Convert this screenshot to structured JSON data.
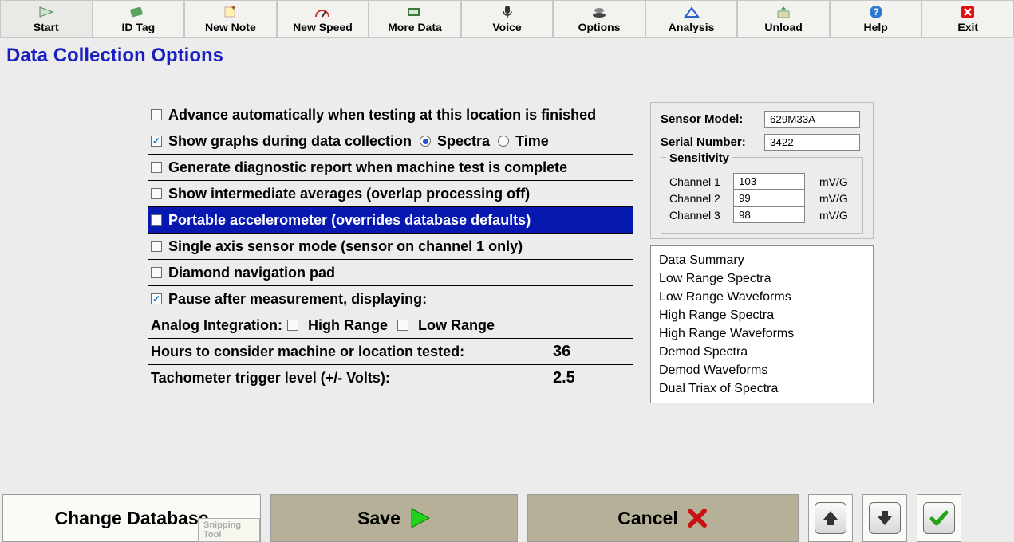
{
  "toolbar": [
    {
      "label": "Start",
      "name": "start-button",
      "icon": "start"
    },
    {
      "label": "ID Tag",
      "name": "idtag-button",
      "icon": "idtag"
    },
    {
      "label": "New Note",
      "name": "newnote-button",
      "icon": "note"
    },
    {
      "label": "New Speed",
      "name": "newspeed-button",
      "icon": "speed"
    },
    {
      "label": "More Data",
      "name": "moredata-button",
      "icon": "moredata"
    },
    {
      "label": "Voice",
      "name": "voice-button",
      "icon": "voice"
    },
    {
      "label": "Options",
      "name": "options-button",
      "icon": "options"
    },
    {
      "label": "Analysis",
      "name": "analysis-button",
      "icon": "analysis"
    },
    {
      "label": "Unload",
      "name": "unload-button",
      "icon": "unload"
    },
    {
      "label": "Help",
      "name": "help-button",
      "icon": "help"
    },
    {
      "label": "Exit",
      "name": "exit-button",
      "icon": "exit"
    }
  ],
  "page_title": "Data Collection Options",
  "options": {
    "advance": "Advance automatically when testing at this location is finished",
    "show_graphs": "Show graphs during data collection",
    "spectra": "Spectra",
    "time": "Time",
    "gen_report": "Generate diagnostic report when machine test is complete",
    "intermediate": "Show intermediate averages (overlap processing off)",
    "portable": "Portable accelerometer (overrides database defaults)",
    "single_axis": "Single axis sensor mode (sensor on channel 1 only)",
    "diamond": "Diamond navigation pad",
    "pause": "Pause after measurement, displaying:",
    "analog_int": "Analog Integration:",
    "high_range": "High Range",
    "low_range": "Low Range",
    "hours_label": "Hours to consider machine or location tested:",
    "hours_value": "36",
    "tach_label": "Tachometer trigger level (+/- Volts):",
    "tach_value": "2.5"
  },
  "sensor": {
    "model_label": "Sensor Model:",
    "model_value": "629M33A",
    "serial_label": "Serial Number:",
    "serial_value": "3422",
    "sensitivity": "Sensitivity",
    "channels": [
      {
        "label": "Channel 1",
        "value": "103",
        "unit": "mV/G"
      },
      {
        "label": "Channel 2",
        "value": "99",
        "unit": "mV/G"
      },
      {
        "label": "Channel 3",
        "value": "98",
        "unit": "mV/G"
      }
    ]
  },
  "display_list": [
    "Data Summary",
    "Low Range Spectra",
    "Low Range Waveforms",
    "High Range Spectra",
    "High Range Waveforms",
    "Demod Spectra",
    "Demod Waveforms",
    "Dual Triax of Spectra"
  ],
  "bottom": {
    "change_db": "Change Database",
    "save": "Save",
    "cancel": "Cancel",
    "snip": "Snipping Tool"
  }
}
